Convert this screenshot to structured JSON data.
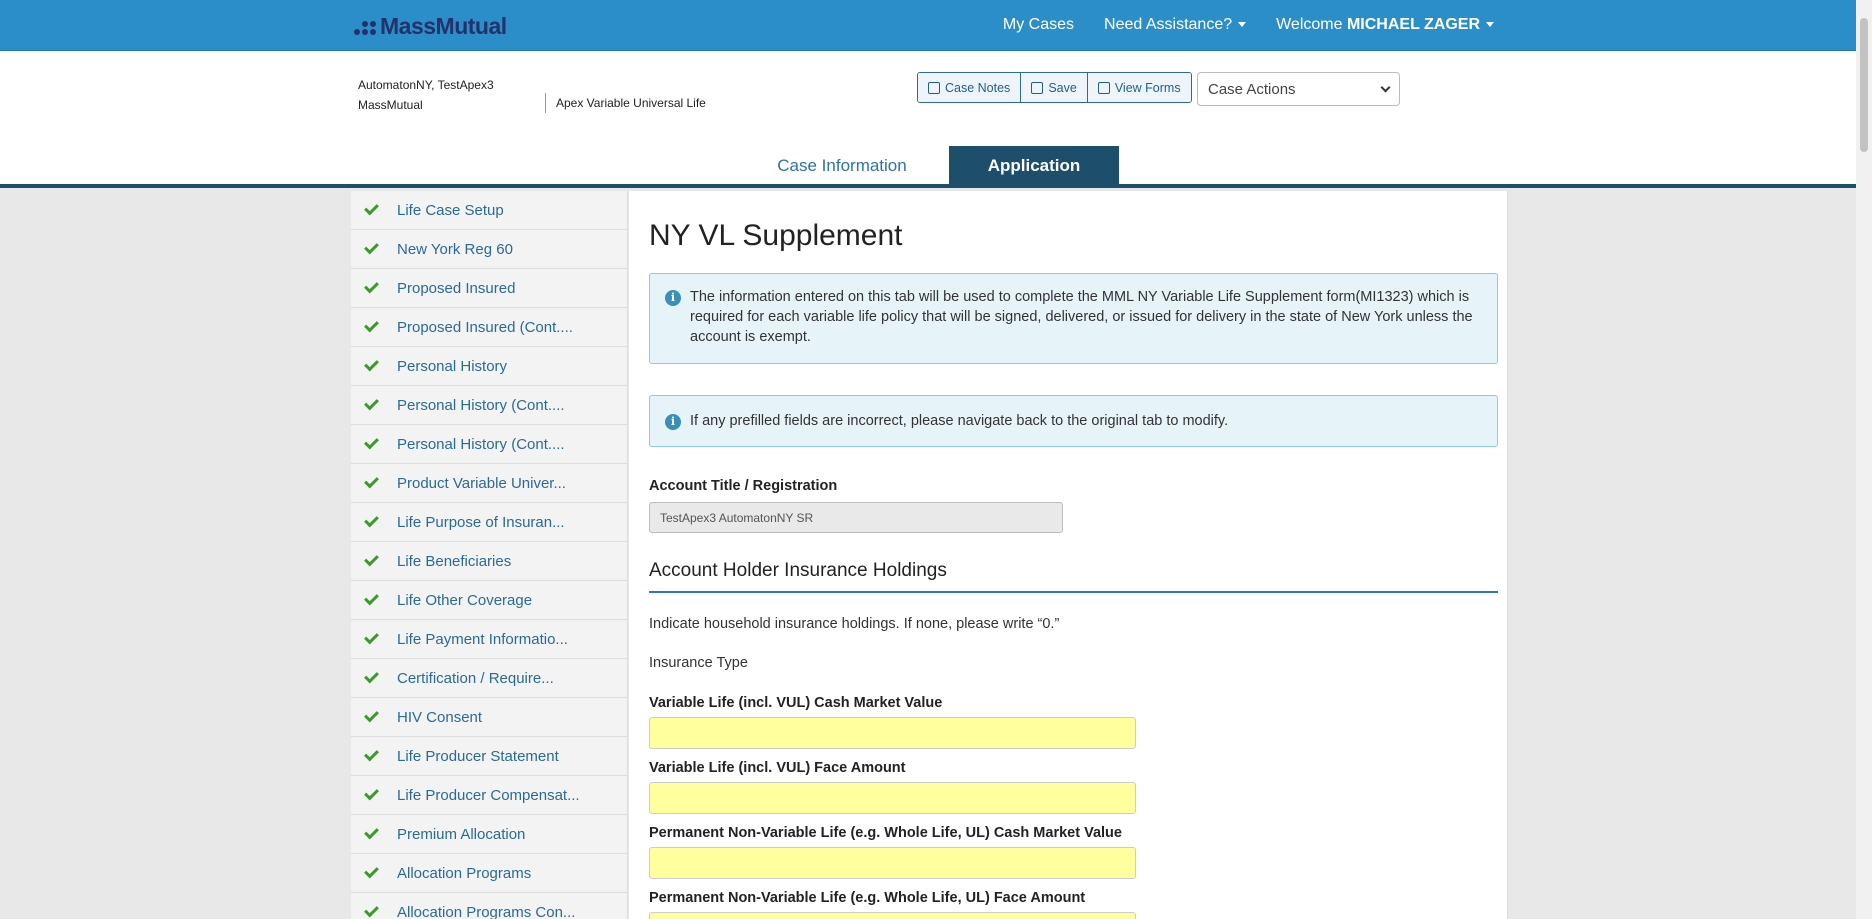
{
  "brand": {
    "name": "MassMutual"
  },
  "nav": {
    "my_cases": "My Cases",
    "need_assistance": "Need Assistance?",
    "welcome_prefix": "Welcome",
    "user_name": "MICHAEL ZAGER"
  },
  "case": {
    "insured_name": "AutomatonNY, TestApex3",
    "carrier": "MassMutual",
    "product": "Apex Variable Universal Life"
  },
  "toolbar": {
    "case_notes": "Case Notes",
    "save": "Save",
    "view_forms": "View Forms",
    "case_actions": "Case Actions"
  },
  "tabs": {
    "case_information": "Case Information",
    "application": "Application"
  },
  "sidebar": {
    "items": [
      {
        "label": "Life Case Setup"
      },
      {
        "label": "New York Reg 60"
      },
      {
        "label": "Proposed Insured"
      },
      {
        "label": "Proposed Insured (Cont...."
      },
      {
        "label": "Personal History"
      },
      {
        "label": "Personal History (Cont...."
      },
      {
        "label": "Personal History (Cont...."
      },
      {
        "label": "Product Variable Univer..."
      },
      {
        "label": "Life Purpose of Insuran..."
      },
      {
        "label": "Life Beneficiaries"
      },
      {
        "label": "Life Other Coverage"
      },
      {
        "label": "Life Payment Informatio..."
      },
      {
        "label": "Certification / Require..."
      },
      {
        "label": "HIV Consent"
      },
      {
        "label": "Life Producer Statement"
      },
      {
        "label": "Life Producer Compensat..."
      },
      {
        "label": "Premium Allocation"
      },
      {
        "label": "Allocation Programs"
      },
      {
        "label": "Allocation Programs Con..."
      }
    ]
  },
  "main": {
    "title": "NY VL Supplement",
    "alert1": "The information entered on this tab will be used to complete the MML NY Variable Life Supplement form(MI1323) which is required for each variable life policy that will be signed, delivered, or issued for delivery in the state of New York unless the account is exempt.",
    "alert2": "If any prefilled fields are incorrect, please navigate back to the original tab to modify.",
    "account_title_label": "Account Title / Registration",
    "account_title_value": "TestApex3 AutomatonNY SR",
    "section_title": "Account Holder Insurance Holdings",
    "instructions": "Indicate household insurance holdings. If none, please write “0.”",
    "insurance_type_label": "Insurance Type",
    "fields": [
      {
        "label": "Variable Life (incl. VUL) Cash Market Value",
        "value": ""
      },
      {
        "label": "Variable Life (incl. VUL) Face Amount",
        "value": ""
      },
      {
        "label": "Permanent Non-Variable Life (e.g. Whole Life, UL) Cash Market Value",
        "value": ""
      },
      {
        "label": "Permanent Non-Variable Life (e.g. Whole Life, UL) Face Amount",
        "value": ""
      }
    ]
  },
  "colors": {
    "nav_bg": "#2b8ec9",
    "brand_navy": "#23326b",
    "tab_active_bg": "#1d4e6c",
    "link_blue": "#2b6a98",
    "check_green": "#3c9a2a",
    "required_yellow": "#ffff9e",
    "alert_bg": "#e6f4f9"
  }
}
